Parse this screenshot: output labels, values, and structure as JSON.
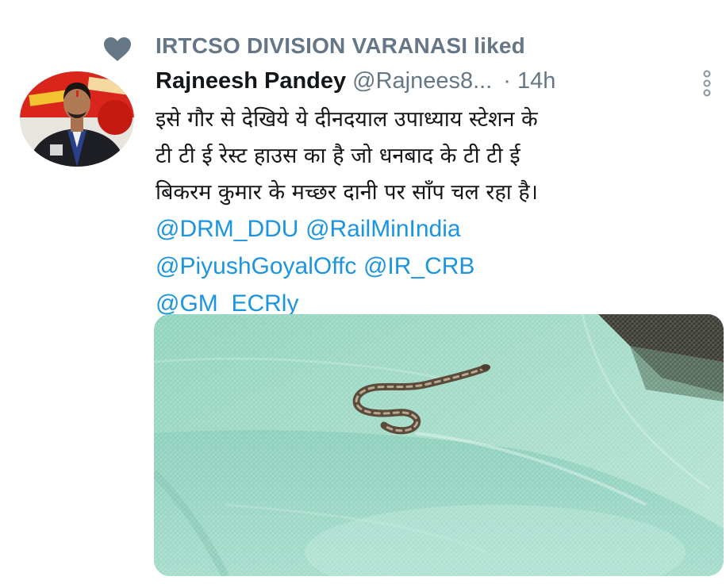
{
  "social_context": {
    "icon": "heart-icon",
    "text": "IRTCSO DIVISION VARANASI liked"
  },
  "tweet": {
    "display_name": "Rajneesh Pandey",
    "handle": "@Rajnees8...",
    "separator": "·",
    "time": "14h",
    "text_lines": [
      "इसे गौर से देखिये ये दीनदयाल उपाध्याय स्टेशन के",
      "टी टी ई रेस्ट हाउस का है जो धनबाद के टी टी ई",
      "बिकरम कुमार के मच्छर दानी पर साँप चल रहा है।"
    ],
    "mentions_lines": [
      [
        "@DRM_DDU",
        "@RailMinIndia"
      ],
      [
        "@PiyushGoyalOffc",
        "@IR_CRB"
      ],
      [
        "@GM_ECRly"
      ]
    ],
    "more_icon": "more-vertical-icon"
  },
  "colors": {
    "secondary_text": "#657786",
    "link": "#1b95e0",
    "primary_text": "#14171a",
    "net_green": "#9ed8c4"
  }
}
